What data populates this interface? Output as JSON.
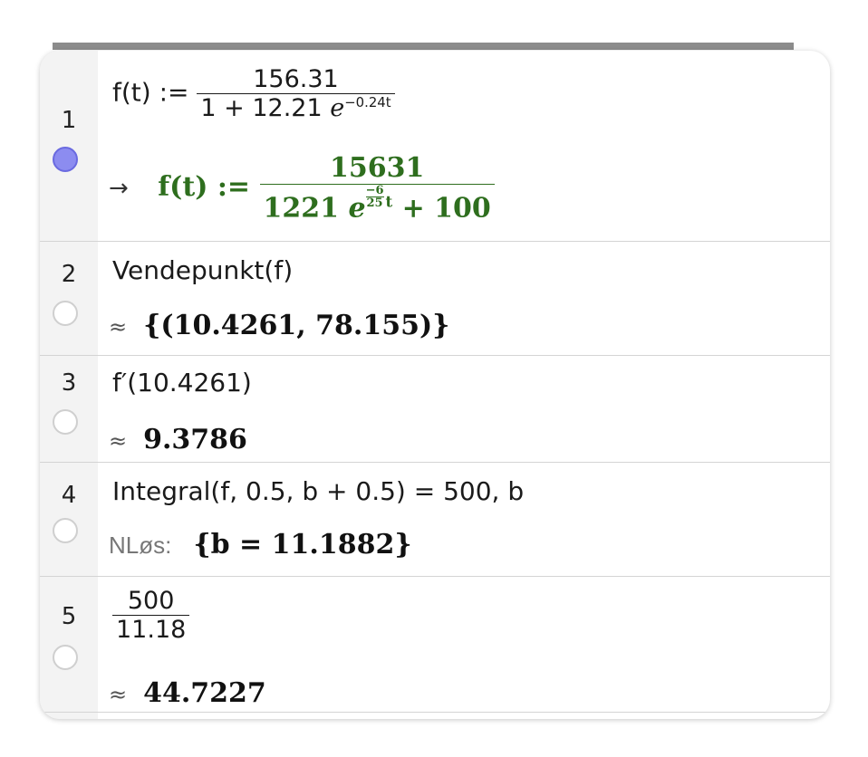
{
  "rows": [
    {
      "number": "1",
      "input": {
        "lhs": "f(t) := ",
        "num": "156.31",
        "den_a": "1 + 12.21 ",
        "den_e": "e",
        "den_exp": "−0.24t"
      },
      "output": {
        "prefix": "→",
        "lhs": "f(t) := ",
        "num": "15631",
        "den_a": "1221 ",
        "den_e": "e",
        "exp_num": "−6",
        "exp_den": "25",
        "exp_t": "t",
        "den_b": " + 100"
      }
    },
    {
      "number": "2",
      "input": "Vendepunkt(f)",
      "output": {
        "prefix": "≈",
        "value": "{(10.4261, 78.155)}"
      }
    },
    {
      "number": "3",
      "input": "f′(10.4261)",
      "output": {
        "prefix": "≈",
        "value": "9.3786"
      }
    },
    {
      "number": "4",
      "input": "Integral(f, 0.5, b + 0.5)  =  500, b",
      "output": {
        "prefix": "NLøs:",
        "value": "{b = 11.1882}"
      }
    },
    {
      "number": "5",
      "input": {
        "num": "500",
        "den": "11.18"
      },
      "output": {
        "prefix": "≈",
        "value": "44.7227"
      }
    }
  ],
  "colors": {
    "output_green": "#2e6e1e",
    "active_dot": "#8c8cf0",
    "gutter": "#f3f3f3",
    "divider": "#d4d4d4"
  }
}
